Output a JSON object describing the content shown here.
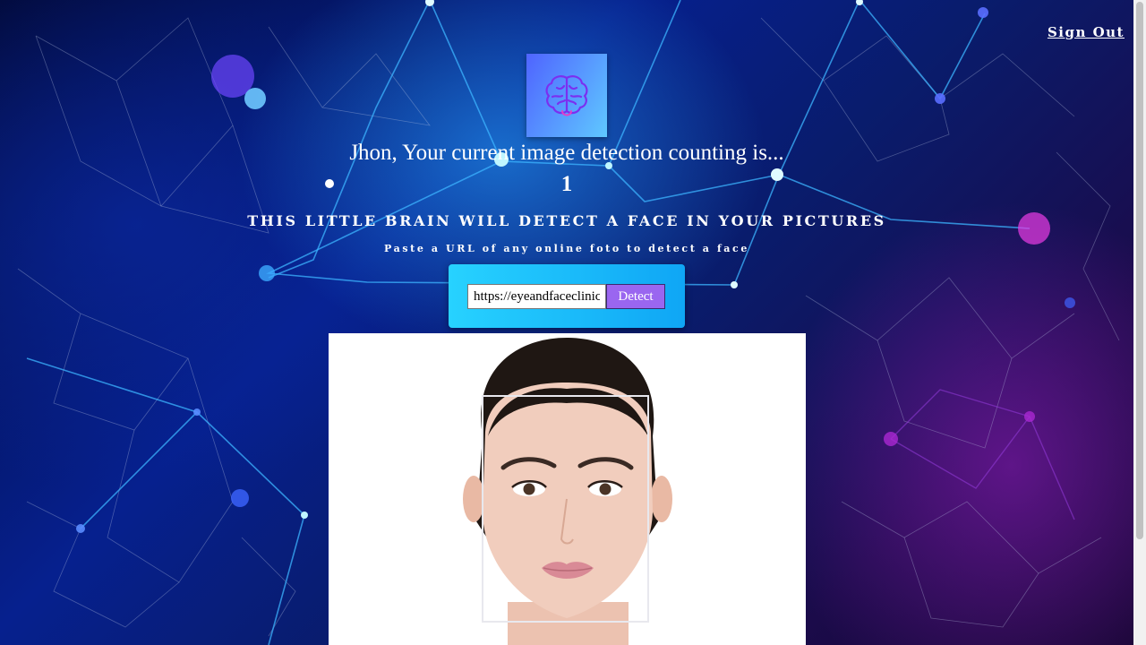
{
  "nav": {
    "signout_label": "Sign Out"
  },
  "logo": {
    "icon": "brain-icon"
  },
  "greeting": {
    "text": "Jhon, Your current image detection counting is...",
    "count": "1"
  },
  "headline": "THIS LITTLE BRAIN WILL DETECT A FACE IN YOUR PICTURES",
  "subline": "Paste a URL of any online foto to detect a face",
  "form": {
    "input_value": "https://eyeandfaceclinic",
    "button_label": "Detect"
  },
  "colors": {
    "logo_gradient_start": "#4f64ff",
    "logo_gradient_end": "#5fc8ff",
    "panel_gradient_start": "#27d2ff",
    "panel_gradient_end": "#0fa6f5",
    "button": "#9a66f0"
  }
}
